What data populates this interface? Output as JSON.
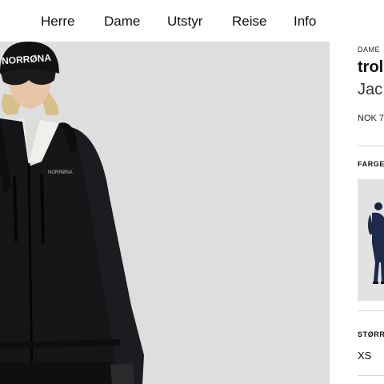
{
  "nav": {
    "items": [
      {
        "label": "Herre"
      },
      {
        "label": "Dame"
      },
      {
        "label": "Utstyr"
      },
      {
        "label": "Reise"
      },
      {
        "label": "Info"
      }
    ]
  },
  "hero": {
    "beanie_text": "NORRØNA",
    "jacket_logo": "NORRØNA"
  },
  "product": {
    "breadcrumb": "DAME",
    "title": "trol",
    "subtitle": "Jac",
    "price": "NOK 7"
  },
  "color_section": {
    "label": "FARGE"
  },
  "size_section": {
    "label": "STØRR",
    "sizes": [
      "XS"
    ]
  },
  "colors": {
    "hero_bg": "#dededf",
    "jacket": "#151618",
    "swatch_jacket": "#1d2a4a"
  }
}
